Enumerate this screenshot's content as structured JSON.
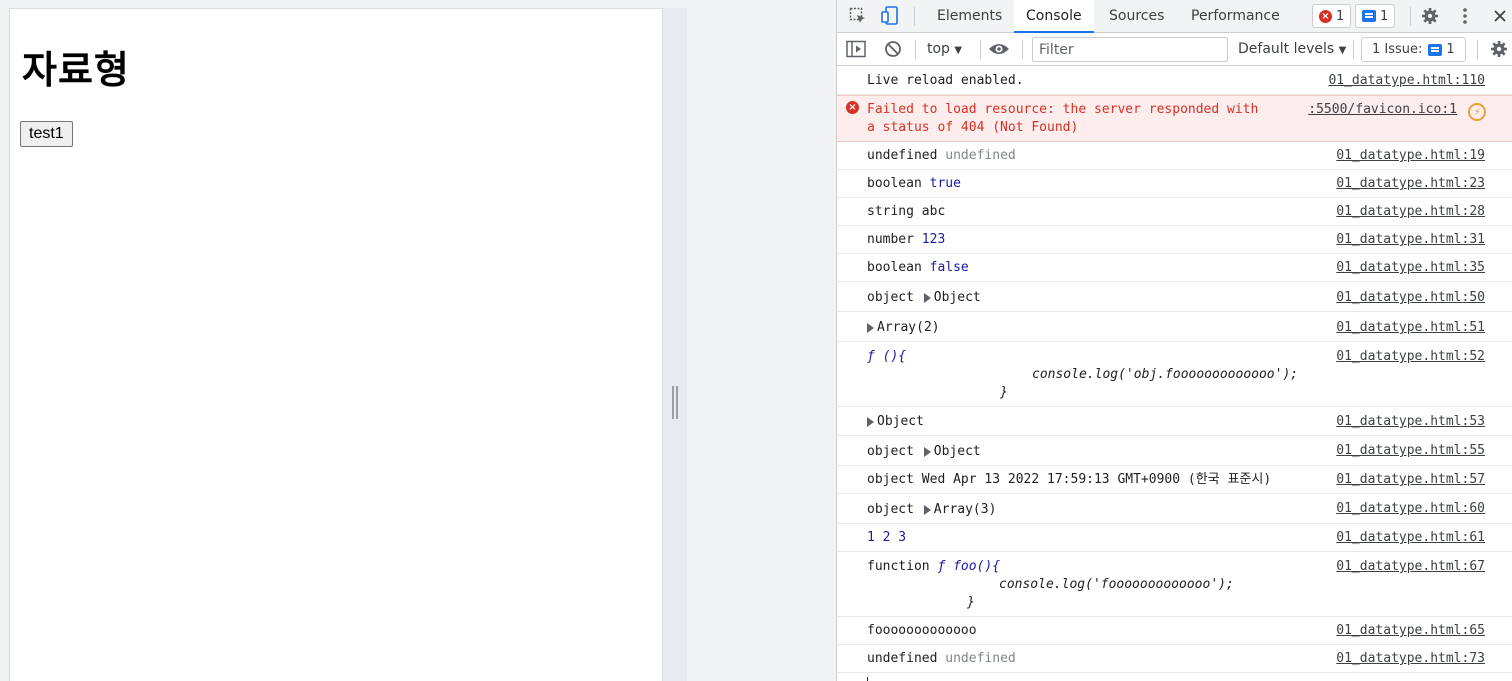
{
  "page": {
    "heading": "자료형",
    "button_label": "test1"
  },
  "devtools": {
    "tabs": [
      "Elements",
      "Console",
      "Sources",
      "Performance"
    ],
    "error_count": "1",
    "message_count": "1",
    "context": "top",
    "filter_placeholder": "Filter",
    "levels": "Default levels",
    "issues_label": "1 Issue:",
    "issues_count": "1"
  },
  "console": {
    "rows": [
      {
        "text": "Live reload enabled.",
        "src": "01_datatype.html:110"
      },
      {
        "text": "Failed to load resource: the server responded with",
        "text2": "a status of 404 (Not Found)",
        "src": ":5500/favicon.ico:1"
      },
      {
        "text": "undefined",
        "value": "undefined",
        "src": "01_datatype.html:19"
      },
      {
        "text": "boolean",
        "value": "true",
        "src": "01_datatype.html:23"
      },
      {
        "text": "string abc",
        "src": "01_datatype.html:28"
      },
      {
        "text": "number",
        "value": "123",
        "src": "01_datatype.html:31"
      },
      {
        "text": "boolean",
        "value": "false",
        "src": "01_datatype.html:35"
      },
      {
        "text": "object",
        "value": "Object",
        "src": "01_datatype.html:50"
      },
      {
        "value": "Array(2)",
        "src": "01_datatype.html:51"
      },
      {
        "line1": "ƒ (){",
        "line2": "console.log('obj.fooooooooooooo');",
        "line3": "}",
        "src": "01_datatype.html:52"
      },
      {
        "value": "Object",
        "src": "01_datatype.html:53"
      },
      {
        "text": "object",
        "value": "Object",
        "src": "01_datatype.html:55"
      },
      {
        "text": "object Wed Apr 13 2022 17:59:13 GMT+0900 (한국 표준시)",
        "src": "01_datatype.html:57"
      },
      {
        "text": "object",
        "value": "Array(3)",
        "src": "01_datatype.html:60"
      },
      {
        "text": "1 2 3",
        "src": "01_datatype.html:61"
      },
      {
        "line1a": "function",
        "line1b": "ƒ foo(){",
        "line2": "console.log('fooooooooooooo');",
        "line3": "}",
        "src": "01_datatype.html:67"
      },
      {
        "text": "fooooooooooooo",
        "src": "01_datatype.html:65"
      },
      {
        "text": "undefined",
        "value": "undefined",
        "src": "01_datatype.html:73"
      }
    ]
  }
}
